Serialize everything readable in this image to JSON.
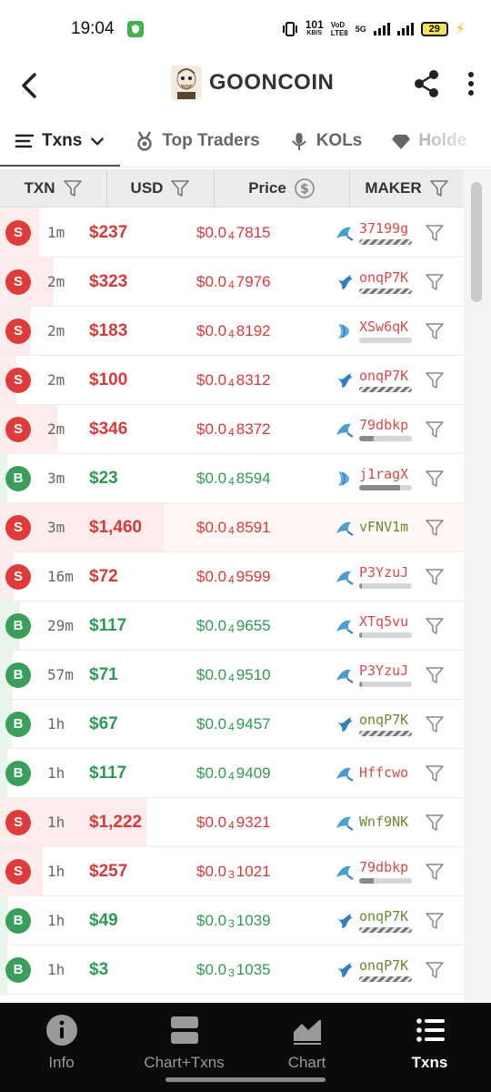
{
  "status_bar": {
    "time": "19:04",
    "net_speed_value": "101",
    "net_speed_unit": "KB/S",
    "volte_top": "VoD",
    "volte_bottom": "LTE8",
    "network": "5G",
    "battery": "29"
  },
  "header": {
    "token_name": "GOONCOIN"
  },
  "tabs": [
    {
      "label": "Txns",
      "active": true
    },
    {
      "label": "Top Traders"
    },
    {
      "label": "KOLs"
    },
    {
      "label": "Holde"
    }
  ],
  "table": {
    "columns": [
      "TXN",
      "USD",
      "Price",
      "MAKER"
    ],
    "rows": [
      {
        "type": "S",
        "age": "1m",
        "usd": "$237",
        "price_prefix": "$0.0",
        "price_zeros": "4",
        "price_digits": "7815",
        "maker": "37199g",
        "icon": "shark",
        "bar": "striped",
        "bar_fill": 0,
        "vol": 0.24
      },
      {
        "type": "S",
        "age": "2m",
        "usd": "$323",
        "price_prefix": "$0.0",
        "price_zeros": "4",
        "price_digits": "7976",
        "maker": "onqP7K",
        "icon": "whale",
        "bar": "striped",
        "bar_fill": 0,
        "vol": 0.33
      },
      {
        "type": "S",
        "age": "2m",
        "usd": "$183",
        "price_prefix": "$0.0",
        "price_zeros": "4",
        "price_digits": "8192",
        "maker": "XSw6qK",
        "icon": "shrimp",
        "bar": "plain",
        "bar_fill": 0,
        "vol": 0.19
      },
      {
        "type": "S",
        "age": "2m",
        "usd": "$100",
        "price_prefix": "$0.0",
        "price_zeros": "4",
        "price_digits": "8312",
        "maker": "onqP7K",
        "icon": "whale",
        "bar": "striped",
        "bar_fill": 0,
        "vol": 0.1
      },
      {
        "type": "S",
        "age": "2m",
        "usd": "$346",
        "price_prefix": "$0.0",
        "price_zeros": "4",
        "price_digits": "8372",
        "maker": "79dbkp",
        "icon": "shark",
        "bar": "plain",
        "bar_fill": 0.28,
        "vol": 0.35
      },
      {
        "type": "B",
        "age": "3m",
        "usd": "$23",
        "price_prefix": "$0.0",
        "price_zeros": "4",
        "price_digits": "8594",
        "maker": "j1ragX",
        "icon": "shrimp",
        "bar": "plain",
        "bar_fill": 0.78,
        "vol": 0.03
      },
      {
        "type": "S",
        "age": "3m",
        "usd": "$1,460",
        "price_prefix": "$0.0",
        "price_zeros": "4",
        "price_digits": "8591",
        "maker": "vFNV1m",
        "icon": "shark",
        "bar": "none",
        "bar_fill": 0,
        "vol": 1.0,
        "green_maker": true
      },
      {
        "type": "S",
        "age": "16m",
        "usd": "$72",
        "price_prefix": "$0.0",
        "price_zeros": "4",
        "price_digits": "9599",
        "maker": "P3YzuJ",
        "icon": "shark",
        "bar": "plain",
        "bar_fill": 0.05,
        "vol": 0.08
      },
      {
        "type": "B",
        "age": "29m",
        "usd": "$117",
        "price_prefix": "$0.0",
        "price_zeros": "4",
        "price_digits": "9655",
        "maker": "XTq5vu",
        "icon": "shark",
        "bar": "plain",
        "bar_fill": 0.05,
        "vol": 0.12
      },
      {
        "type": "B",
        "age": "57m",
        "usd": "$71",
        "price_prefix": "$0.0",
        "price_zeros": "4",
        "price_digits": "9510",
        "maker": "P3YzuJ",
        "icon": "shark",
        "bar": "plain",
        "bar_fill": 0.05,
        "vol": 0.08
      },
      {
        "type": "B",
        "age": "1h",
        "usd": "$67",
        "price_prefix": "$0.0",
        "price_zeros": "4",
        "price_digits": "9457",
        "maker": "onqP7K",
        "icon": "whale",
        "bar": "striped",
        "bar_fill": 0,
        "vol": 0.07,
        "green_maker": true
      },
      {
        "type": "B",
        "age": "1h",
        "usd": "$117",
        "price_prefix": "$0.0",
        "price_zeros": "4",
        "price_digits": "9409",
        "maker": "Hffcwo",
        "icon": "shark",
        "bar": "none",
        "bar_fill": 0,
        "vol": 0.02
      },
      {
        "type": "S",
        "age": "1h",
        "usd": "$1,222",
        "price_prefix": "$0.0",
        "price_zeros": "4",
        "price_digits": "9321",
        "maker": "Wnf9NK",
        "icon": "shark",
        "bar": "none",
        "bar_fill": 0,
        "vol": 0.9,
        "green_maker": true
      },
      {
        "type": "S",
        "age": "1h",
        "usd": "$257",
        "price_prefix": "$0.0",
        "price_zeros": "3",
        "price_digits": "1021",
        "maker": "79dbkp",
        "icon": "shark",
        "bar": "plain",
        "bar_fill": 0.28,
        "vol": 0.26
      },
      {
        "type": "B",
        "age": "1h",
        "usd": "$49",
        "price_prefix": "$0.0",
        "price_zeros": "3",
        "price_digits": "1039",
        "maker": "onqP7K",
        "icon": "whale",
        "bar": "striped",
        "bar_fill": 0,
        "vol": 0.05,
        "green_maker": true
      },
      {
        "type": "B",
        "age": "1h",
        "usd": "$3",
        "price_prefix": "$0.0",
        "price_zeros": "3",
        "price_digits": "1035",
        "maker": "onqP7K",
        "icon": "whale",
        "bar": "striped",
        "bar_fill": 0,
        "vol": 0.01,
        "green_maker": true
      }
    ]
  },
  "colors": {
    "sell": "#d83a3a",
    "buy": "#2f9a56"
  },
  "bottom_nav": [
    {
      "label": "Info",
      "icon": "info-icon"
    },
    {
      "label": "Chart+Txns",
      "icon": "split-view-icon"
    },
    {
      "label": "Chart",
      "icon": "area-chart-icon"
    },
    {
      "label": "Txns",
      "icon": "list-icon",
      "active": true
    }
  ]
}
